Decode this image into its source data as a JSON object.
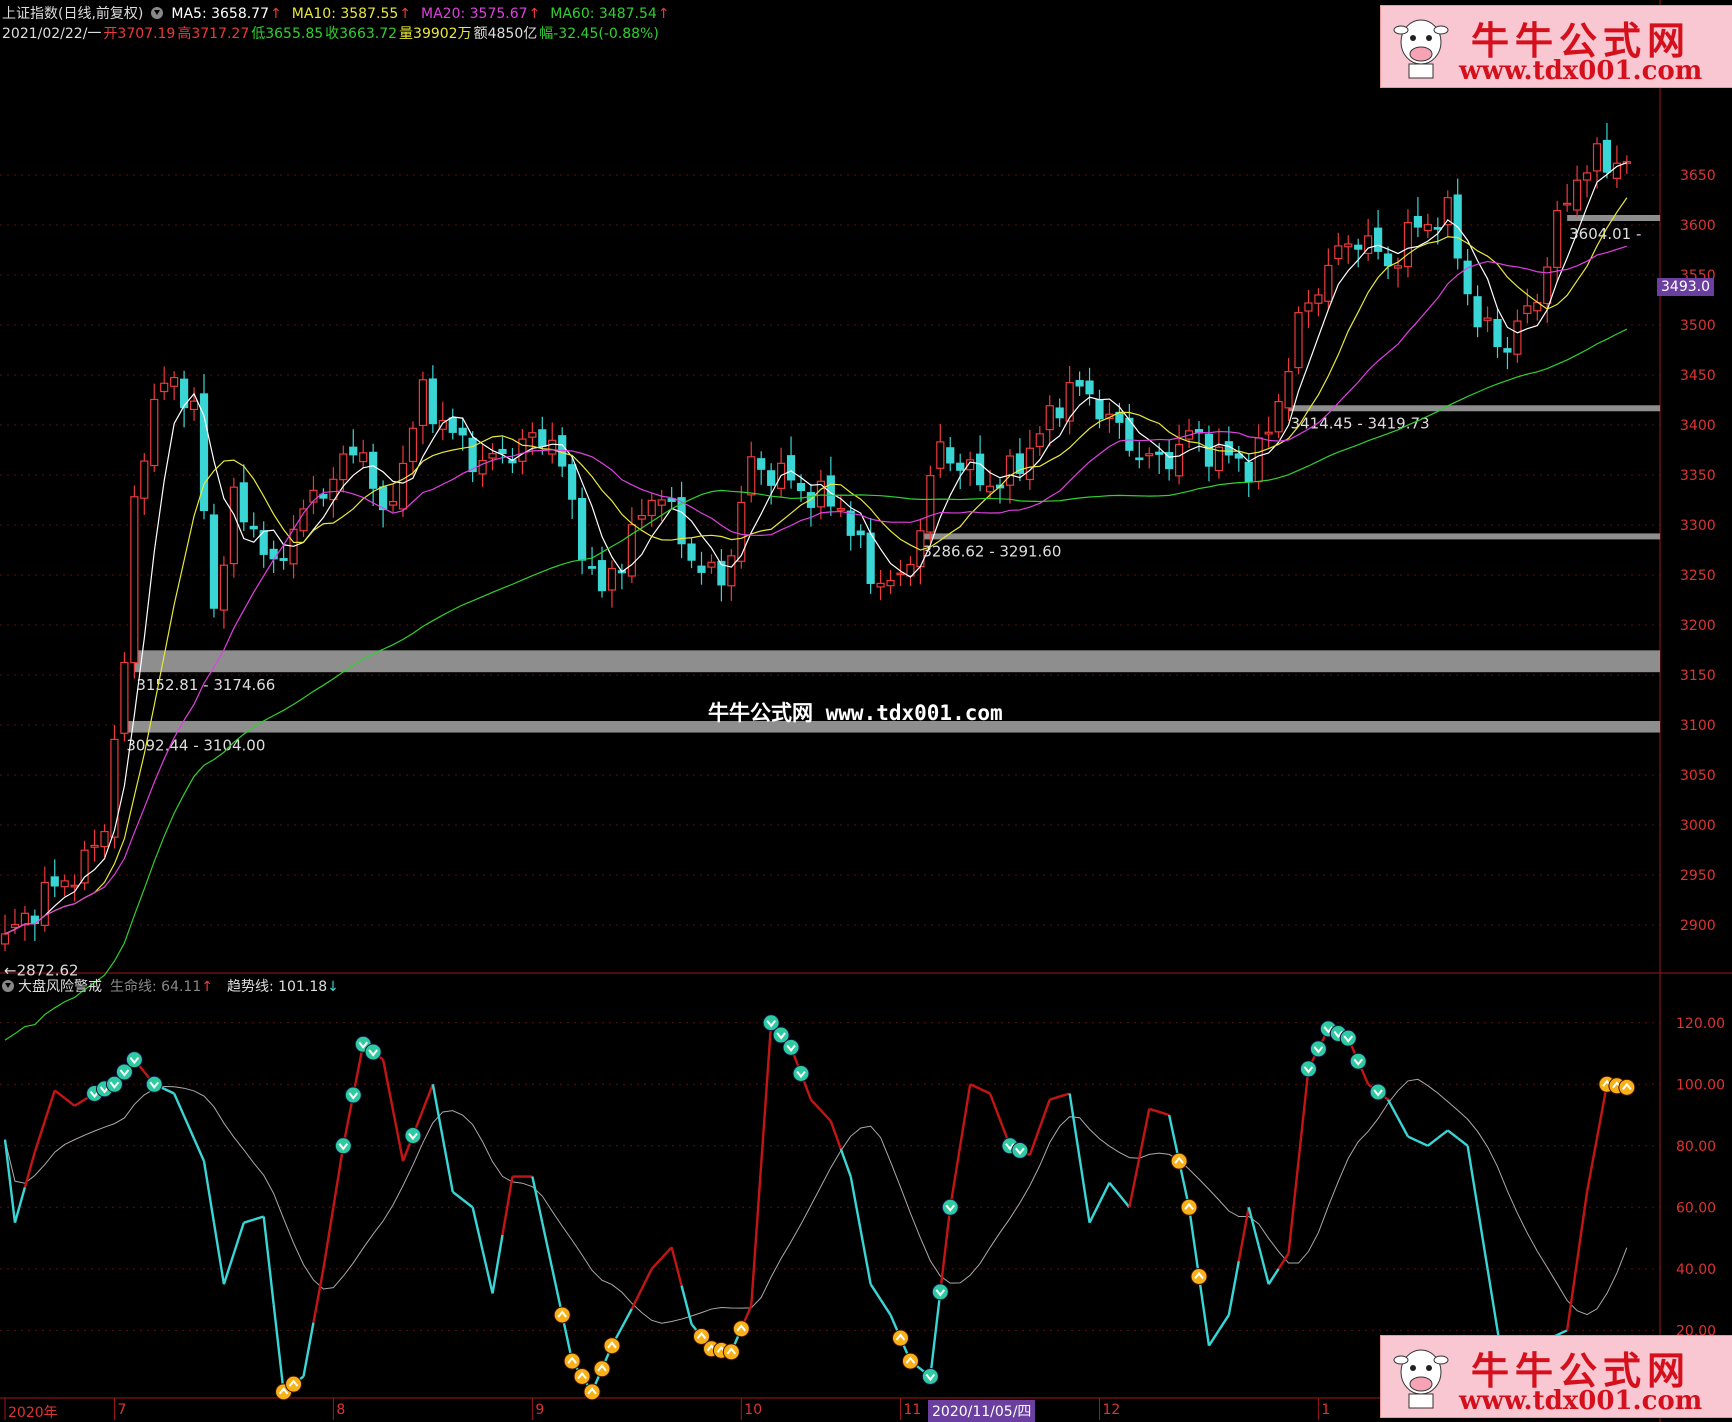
{
  "header": {
    "index_name": "上证指数(日线,前复权)",
    "ma": [
      {
        "label": "MA5: 3658.77",
        "color": "#ffffff"
      },
      {
        "label": "MA10: 3587.55",
        "color": "#e8e83a"
      },
      {
        "label": "MA20: 3575.67",
        "color": "#e040e0"
      },
      {
        "label": "MA60: 3487.54",
        "color": "#30d030"
      }
    ],
    "arrow_up": "↑",
    "arrow_down": "↓",
    "date": "2021/02/22/一",
    "open": "开3707.19",
    "high": "高3717.27",
    "low": "低3655.85",
    "close": "收3663.72",
    "volume": "量39902万",
    "amount": "额4850亿",
    "change": "幅-32.45(-0.88%)"
  },
  "indicator_header": {
    "name": "大盘风险警戒",
    "life_line": "生命线: 64.11",
    "trend_line": "趋势线: 101.18"
  },
  "zones": [
    {
      "label": "3152.81 - 3174.66",
      "lo": 3152.81,
      "hi": 3174.66,
      "start": 13
    },
    {
      "label": "3092.44 - 3104.00",
      "lo": 3092.44,
      "hi": 3104.0,
      "start": 12
    },
    {
      "label": "3286.62 - 3291.60",
      "lo": 3286.62,
      "hi": 3291.6,
      "start": 92
    },
    {
      "label": "3414.45 - 3419.73",
      "lo": 3414.45,
      "hi": 3419.73,
      "start": 129
    },
    {
      "label": "3604.01 -",
      "lo": 3604.01,
      "hi": 3610.0,
      "start": 157
    }
  ],
  "low_label": "←2872.62",
  "price_tag": "3493.0",
  "watermark": "牛牛公式网 www.tdx001.com",
  "logo": {
    "cn": "牛牛公式网",
    "url": "www.tdx001.com"
  },
  "xaxis": {
    "labels": [
      {
        "text": "2020年",
        "i": 0
      },
      {
        "text": "7",
        "i": 11
      },
      {
        "text": "8",
        "i": 33
      },
      {
        "text": "9",
        "i": 53
      },
      {
        "text": "10",
        "i": 74
      },
      {
        "text": "11",
        "i": 90
      },
      {
        "text": "12",
        "i": 110
      },
      {
        "text": "1",
        "i": 132
      }
    ],
    "highlight": "2020/11/05/四"
  },
  "chart_data": {
    "type": "candlestick",
    "price_axis": {
      "ylim": [
        2850,
        3780
      ],
      "ticks": [
        2900,
        2950,
        3000,
        3050,
        3100,
        3150,
        3200,
        3250,
        3300,
        3350,
        3400,
        3450,
        3500,
        3550,
        3600,
        3650
      ]
    },
    "indicator_axis": {
      "ylim": [
        -2,
        130
      ],
      "ticks": [
        20.0,
        40.0,
        60.0,
        80.0,
        100.0,
        120.0
      ]
    },
    "close_anchors": [
      [
        0,
        2885
      ],
      [
        4,
        2930
      ],
      [
        8,
        2960
      ],
      [
        10,
        3000
      ],
      [
        11,
        3090
      ],
      [
        12,
        3150
      ],
      [
        13,
        3330
      ],
      [
        15,
        3420
      ],
      [
        17,
        3450
      ],
      [
        19,
        3410
      ],
      [
        21,
        3220
      ],
      [
        23,
        3320
      ],
      [
        25,
        3300
      ],
      [
        27,
        3250
      ],
      [
        29,
        3300
      ],
      [
        33,
        3350
      ],
      [
        36,
        3380
      ],
      [
        38,
        3300
      ],
      [
        42,
        3430
      ],
      [
        45,
        3390
      ],
      [
        48,
        3360
      ],
      [
        52,
        3380
      ],
      [
        55,
        3390
      ],
      [
        58,
        3280
      ],
      [
        60,
        3230
      ],
      [
        63,
        3290
      ],
      [
        66,
        3340
      ],
      [
        68,
        3280
      ],
      [
        72,
        3240
      ],
      [
        75,
        3360
      ],
      [
        78,
        3350
      ],
      [
        81,
        3330
      ],
      [
        84,
        3320
      ],
      [
        87,
        3250
      ],
      [
        90,
        3240
      ],
      [
        92,
        3300
      ],
      [
        94,
        3380
      ],
      [
        97,
        3350
      ],
      [
        100,
        3340
      ],
      [
        104,
        3390
      ],
      [
        107,
        3440
      ],
      [
        110,
        3420
      ],
      [
        113,
        3380
      ],
      [
        116,
        3360
      ],
      [
        119,
        3390
      ],
      [
        122,
        3370
      ],
      [
        125,
        3360
      ],
      [
        127,
        3390
      ],
      [
        130,
        3500
      ],
      [
        133,
        3560
      ],
      [
        136,
        3590
      ],
      [
        139,
        3560
      ],
      [
        142,
        3600
      ],
      [
        145,
        3610
      ],
      [
        148,
        3500
      ],
      [
        151,
        3480
      ],
      [
        154,
        3530
      ],
      [
        156,
        3600
      ],
      [
        158,
        3650
      ],
      [
        160,
        3664
      ]
    ],
    "indicator_anchors": [
      [
        0,
        82
      ],
      [
        1,
        55
      ],
      [
        3,
        78
      ],
      [
        5,
        98
      ],
      [
        7,
        93
      ],
      [
        9,
        97
      ],
      [
        11,
        100
      ],
      [
        13,
        108
      ],
      [
        15,
        100
      ],
      [
        17,
        97
      ],
      [
        20,
        75
      ],
      [
        22,
        35
      ],
      [
        24,
        55
      ],
      [
        26,
        57
      ],
      [
        28,
        0
      ],
      [
        30,
        5
      ],
      [
        32,
        40
      ],
      [
        34,
        80
      ],
      [
        36,
        113
      ],
      [
        38,
        108
      ],
      [
        40,
        75
      ],
      [
        43,
        100
      ],
      [
        45,
        65
      ],
      [
        47,
        60
      ],
      [
        49,
        32
      ],
      [
        51,
        70
      ],
      [
        53,
        70
      ],
      [
        55,
        40
      ],
      [
        57,
        10
      ],
      [
        59,
        0
      ],
      [
        61,
        15
      ],
      [
        63,
        27
      ],
      [
        65,
        40
      ],
      [
        67,
        47
      ],
      [
        69,
        22
      ],
      [
        71,
        14
      ],
      [
        73,
        13
      ],
      [
        75,
        28
      ],
      [
        77,
        120
      ],
      [
        79,
        112
      ],
      [
        81,
        95
      ],
      [
        83,
        88
      ],
      [
        85,
        70
      ],
      [
        87,
        35
      ],
      [
        89,
        25
      ],
      [
        91,
        10
      ],
      [
        93,
        5
      ],
      [
        95,
        60
      ],
      [
        97,
        100
      ],
      [
        99,
        97
      ],
      [
        101,
        80
      ],
      [
        103,
        77
      ],
      [
        105,
        95
      ],
      [
        107,
        97
      ],
      [
        109,
        55
      ],
      [
        111,
        68
      ],
      [
        113,
        60
      ],
      [
        115,
        92
      ],
      [
        117,
        90
      ],
      [
        119,
        60
      ],
      [
        121,
        15
      ],
      [
        123,
        25
      ],
      [
        125,
        60
      ],
      [
        127,
        35
      ],
      [
        129,
        45
      ],
      [
        131,
        105
      ],
      [
        133,
        118
      ],
      [
        135,
        115
      ],
      [
        137,
        100
      ],
      [
        139,
        95
      ],
      [
        141,
        83
      ],
      [
        143,
        80
      ],
      [
        145,
        85
      ],
      [
        147,
        80
      ],
      [
        149,
        40
      ],
      [
        151,
        0
      ],
      [
        153,
        5
      ],
      [
        155,
        17
      ],
      [
        157,
        20
      ],
      [
        159,
        65
      ],
      [
        161,
        100
      ],
      [
        163,
        99
      ]
    ],
    "sell_markers": [
      9,
      10,
      11,
      12,
      13,
      15,
      34,
      35,
      36,
      37,
      41,
      77,
      78,
      79,
      80,
      93,
      94,
      95,
      101,
      102,
      131,
      132,
      133,
      134,
      135,
      136,
      138
    ],
    "buy_markers": [
      28,
      29,
      56,
      57,
      58,
      59,
      60,
      61,
      70,
      71,
      72,
      73,
      74,
      90,
      91,
      118,
      119,
      120,
      161,
      162,
      163
    ],
    "series_colors": {
      "up": "#ec3a3a",
      "down": "#3ad6d6",
      "ma5": "#ffffff",
      "ma10": "#e8e83a",
      "ma20": "#e040e0",
      "ma60": "#30d030"
    }
  }
}
